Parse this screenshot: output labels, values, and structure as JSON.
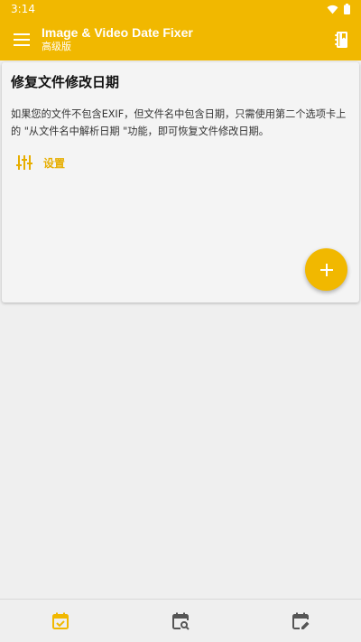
{
  "status_bar": {
    "time": "3:14"
  },
  "app_bar": {
    "title": "Image & Video Date Fixer",
    "subtitle": "高级版"
  },
  "card": {
    "title": "修复文件修改日期",
    "description": "如果您的文件不包含EXIF，但文件名中包含日期，只需使用第二个选项卡上的 \"从文件名中解析日期 \"功能，即可恢复文件修改日期。",
    "settings_label": "设置"
  },
  "colors": {
    "primary": "#f1b800",
    "accent_text": "#e7ae00",
    "background": "#efefef",
    "nav_icon": "#555555"
  },
  "icons": {
    "menu": "menu-icon",
    "action": "notebook-icon",
    "settings": "tune-icon",
    "fab": "plus-icon",
    "nav": [
      "calendar-check-icon",
      "calendar-search-icon",
      "calendar-edit-icon"
    ]
  }
}
